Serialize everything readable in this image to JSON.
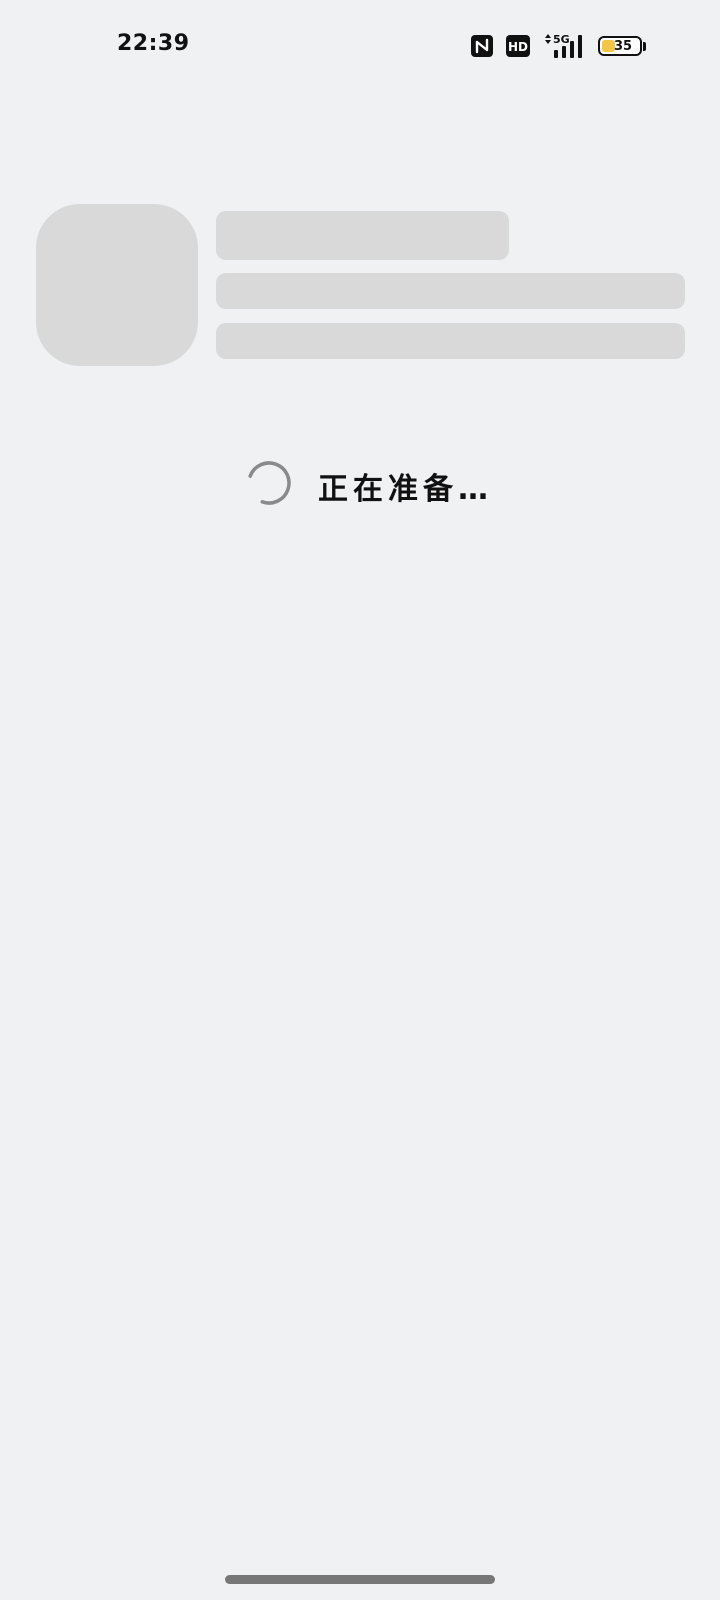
{
  "status_bar": {
    "time": "22:39",
    "network": "5G",
    "hd_label": "HD",
    "battery_level": "35",
    "battery_percent": 35,
    "icons": [
      "nfc-icon",
      "hd-icon",
      "signal-5g-icon",
      "battery-icon"
    ]
  },
  "loading": {
    "text": "正在准备…",
    "spinner_icon": "spinner-icon"
  },
  "colors": {
    "background": "#f0f1f3",
    "skeleton": "#d9d9d9",
    "text": "#111111",
    "battery_fill": "#f5c646",
    "home_indicator": "#777777"
  }
}
